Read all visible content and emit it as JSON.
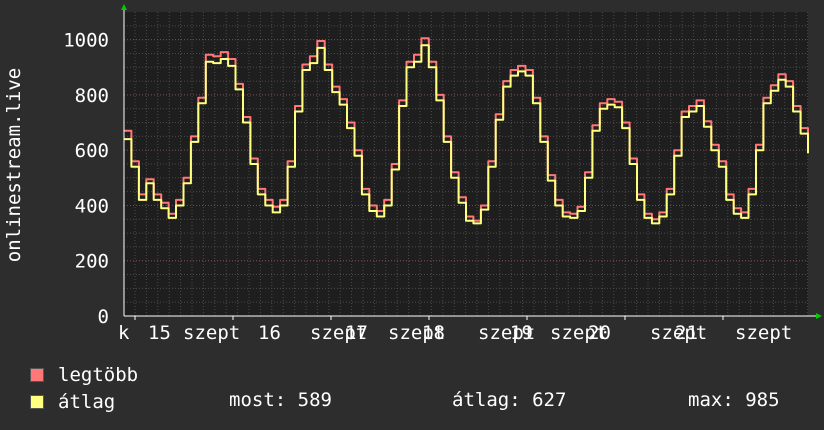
{
  "chart_data": {
    "type": "line",
    "ylabel": "onlinestream.live",
    "ylim": [
      0,
      1100
    ],
    "yticks": [
      0,
      200,
      400,
      600,
      800,
      1000
    ],
    "grid": true,
    "xtick_labels": [
      "k",
      "15",
      "szept",
      "16",
      "szept",
      "17",
      "szept",
      "18",
      "szept",
      "19",
      "szept",
      "20",
      "szept",
      "21",
      "szept"
    ],
    "series": [
      {
        "name": "legtöbb",
        "color": "#ff7777",
        "values": [
          670,
          560,
          440,
          495,
          440,
          410,
          370,
          420,
          500,
          650,
          790,
          945,
          940,
          955,
          930,
          840,
          720,
          570,
          460,
          420,
          395,
          420,
          560,
          760,
          910,
          940,
          995,
          910,
          830,
          785,
          700,
          600,
          460,
          400,
          380,
          420,
          550,
          780,
          920,
          945,
          1005,
          920,
          800,
          650,
          520,
          430,
          360,
          345,
          400,
          560,
          730,
          850,
          890,
          905,
          890,
          790,
          650,
          510,
          420,
          375,
          370,
          395,
          520,
          690,
          770,
          785,
          775,
          700,
          570,
          440,
          370,
          350,
          375,
          460,
          600,
          740,
          760,
          780,
          705,
          620,
          560,
          440,
          390,
          375,
          460,
          620,
          790,
          835,
          875,
          850,
          760,
          680,
          600
        ]
      },
      {
        "name": "átlag",
        "color": "#ffff80",
        "values": [
          640,
          540,
          420,
          480,
          420,
          390,
          355,
          400,
          480,
          630,
          770,
          920,
          915,
          930,
          905,
          820,
          700,
          550,
          440,
          400,
          375,
          400,
          540,
          740,
          890,
          915,
          970,
          890,
          810,
          765,
          680,
          580,
          440,
          380,
          360,
          400,
          530,
          760,
          900,
          920,
          980,
          900,
          780,
          630,
          500,
          410,
          345,
          335,
          385,
          540,
          710,
          830,
          870,
          885,
          870,
          770,
          630,
          490,
          400,
          360,
          355,
          380,
          500,
          670,
          750,
          765,
          755,
          680,
          550,
          420,
          355,
          335,
          360,
          440,
          580,
          720,
          740,
          760,
          685,
          600,
          540,
          420,
          370,
          355,
          440,
          600,
          770,
          815,
          855,
          830,
          740,
          660,
          589
        ]
      }
    ]
  },
  "legend": {
    "max_label": "legtöbb",
    "avg_label": "átlag",
    "max_color": "#ff7777",
    "avg_color": "#ffff80"
  },
  "stats": {
    "now": "most: 589",
    "avg": "átlag: 627",
    "max": "max: 985"
  }
}
